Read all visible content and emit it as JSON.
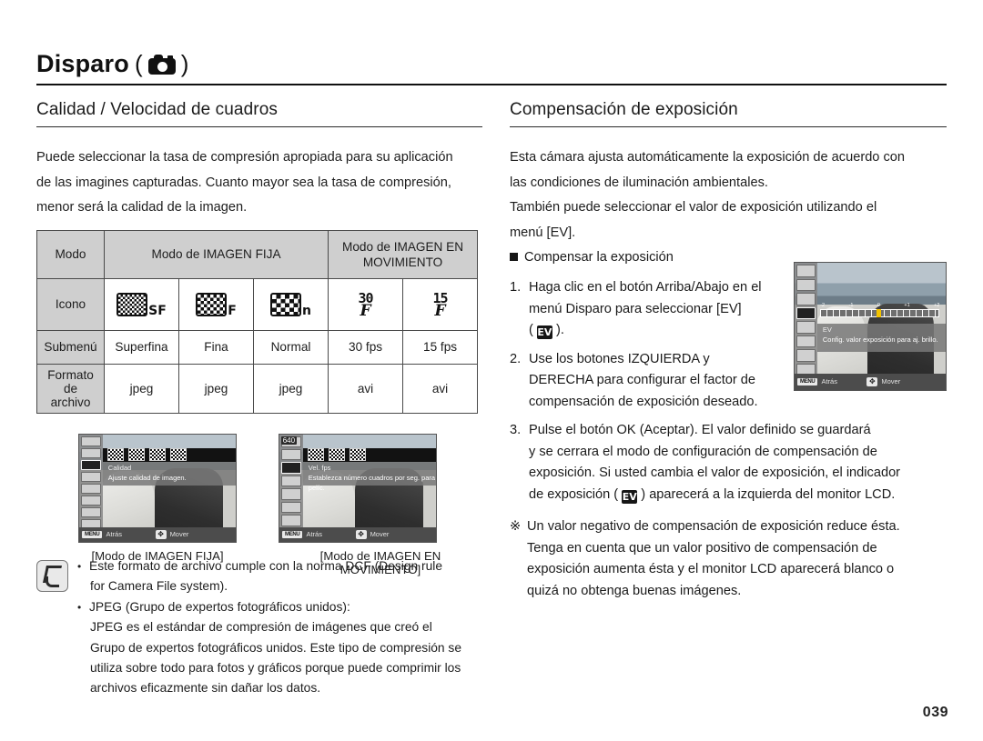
{
  "header": {
    "chapter_title": "Disparo",
    "paren_open": "(",
    "paren_close": ")",
    "camera_icon": "camera-icon"
  },
  "left_column": {
    "section_title": "Calidad / Velocidad de cuadros",
    "intro_lines": [
      "Puede seleccionar la tasa de compresión apropiada para su aplicación",
      "de las imagines capturadas. Cuanto mayor sea la tasa de compresión,",
      "menor será la calidad de la imagen."
    ],
    "table": {
      "header": {
        "row_label": "Modo",
        "still_image": "Modo de IMAGEN FIJA",
        "moving_image_line1": "Modo de IMAGEN EN",
        "moving_image_line2": "MOVIMIENTO"
      },
      "rows": [
        {
          "label": "Icono",
          "icons": [
            {
              "type": "quality",
              "plate": "sf",
              "label": "SF"
            },
            {
              "type": "quality",
              "plate": "f",
              "label": "F"
            },
            {
              "type": "quality",
              "plate": "n",
              "label": "n"
            },
            {
              "type": "fps",
              "num": "30",
              "mark": "F"
            },
            {
              "type": "fps",
              "num": "15",
              "mark": "F"
            }
          ]
        },
        {
          "label": "Submenú",
          "values": [
            "Superfina",
            "Fina",
            "Normal",
            "30 fps",
            "15 fps"
          ]
        },
        {
          "label_line1": "Formato de",
          "label_line2": "archivo",
          "values": [
            "jpeg",
            "jpeg",
            "jpeg",
            "avi",
            "avi"
          ]
        }
      ]
    },
    "lcd_still": {
      "msg_title": "Calidad",
      "msg_desc": "Ajuste calidad de imagen.",
      "back_key": "MENU",
      "back_label": "Atrás",
      "move_label": "Mover",
      "caption": "[Modo de IMAGEN FIJA]"
    },
    "lcd_movie": {
      "resolution": "640",
      "msg_title": "Vel. fps",
      "msg_desc": "Establezca número cuadros por seg. para pelíc.",
      "back_key": "MENU",
      "back_label": "Atrás",
      "move_label": "Mover",
      "caption": "[Modo de IMAGEN EN MOVIMIENTO]"
    },
    "note": {
      "icon": "note-pen-icon",
      "items": [
        {
          "line1": "Este formato de archivo cumple con la norma DCF (Design rule",
          "line2": "for Camera File system)."
        },
        {
          "line1": "JPEG (Grupo de expertos fotográficos unidos):",
          "continuation": [
            "JPEG es el estándar de compresión de imágenes que creó el",
            "Grupo de expertos fotográficos unidos. Este tipo de compresión se",
            "utiliza sobre todo para fotos y gráficos porque puede comprimir los",
            "archivos eficazmente sin dañar los datos."
          ]
        }
      ]
    }
  },
  "right_column": {
    "section_title": "Compensación de exposición",
    "intro_lines": [
      "Esta cámara ajusta automáticamente la exposición de acuerdo con",
      "las condiciones de iluminación ambientales.",
      "También puede seleccionar el valor de exposición utilizando el",
      "menú [EV]."
    ],
    "subhead": "Compensar la exposición",
    "steps": [
      {
        "num": "1.",
        "lines": [
          "Haga clic en el botón Arriba/Abajo en el",
          "menú Disparo para seleccionar [EV]"
        ],
        "glyph_line_prefix": "(",
        "glyph": "EV",
        "glyph_line_suffix": ")."
      },
      {
        "num": "2.",
        "lines": [
          "Use los botones IZQUIERDA y",
          "DERECHA para configurar el factor de",
          "compensación de exposición deseado."
        ]
      },
      {
        "num": "3.",
        "lines_a": [
          "Pulse el botón OK (Aceptar). El valor definido se guardará",
          "y se cerrara el modo de configuración de compensación de",
          "exposición. Si usted cambia el valor de exposición, el indicador"
        ],
        "last_prefix": "de exposición ( ",
        "glyph": "EV",
        "last_suffix": " )  aparecerá a la izquierda del monitor LCD."
      }
    ],
    "star_note": {
      "star": "※",
      "lines": [
        "Un valor negativo de compensación de exposición reduce ésta.",
        "Tenga en cuenta que un valor positivo de compensación de",
        "exposición aumenta ésta y el monitor LCD aparecerá blanco o",
        "quizá no obtenga buenas imágenes."
      ]
    },
    "lcd_ev": {
      "msg_title": "EV",
      "msg_desc": "Config. valor exposición para aj. brillo.",
      "scale_ticks": [
        "-2",
        "-1",
        "0",
        "+1",
        "+2"
      ],
      "back_key": "MENU",
      "back_label": "Atrás",
      "move_label": "Mover"
    }
  },
  "footer": {
    "page_number": "039"
  },
  "colors": {
    "text": "#1d1d1d",
    "rule": "#2a2a2a",
    "table_header_bg": "#cfcfcf",
    "lcd_bg": "#8e8e8e"
  }
}
